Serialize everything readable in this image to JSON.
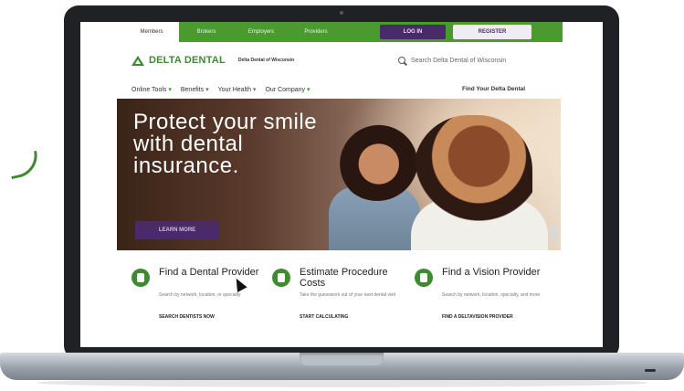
{
  "topbar": {
    "tabs": [
      "Members",
      "Brokers",
      "Employers",
      "Providers"
    ],
    "login_label": "LOG IN",
    "register_label": "REGISTER"
  },
  "header": {
    "logo": "DELTA DENTAL",
    "logo_sub": "Delta Dental of Wisconsin",
    "search_placeholder": "Search Delta Dental of Wisconsin"
  },
  "nav": {
    "items": [
      "Online Tools",
      "Benefits",
      "Your Health",
      "Our Company"
    ],
    "right_link": "Find Your Delta Dental"
  },
  "hero": {
    "title": "Protect your smile with dental insurance.",
    "button": "LEARN MORE"
  },
  "features": [
    {
      "title": "Find a Dental Provider",
      "desc": "Search by network, location, or specialty",
      "link": "SEARCH DENTISTS NOW"
    },
    {
      "title": "Estimate Procedure Costs",
      "desc": "Take the guesswork out of your next dental visit",
      "link": "START CALCULATING"
    },
    {
      "title": "Find a Vision Provider",
      "desc": "Search by network, location, specialty, and more",
      "link": "FIND A DELTAVISION PROVIDER"
    }
  ],
  "colors": {
    "brand_green": "#3d8b2e",
    "brand_purple": "#4b2a69"
  }
}
